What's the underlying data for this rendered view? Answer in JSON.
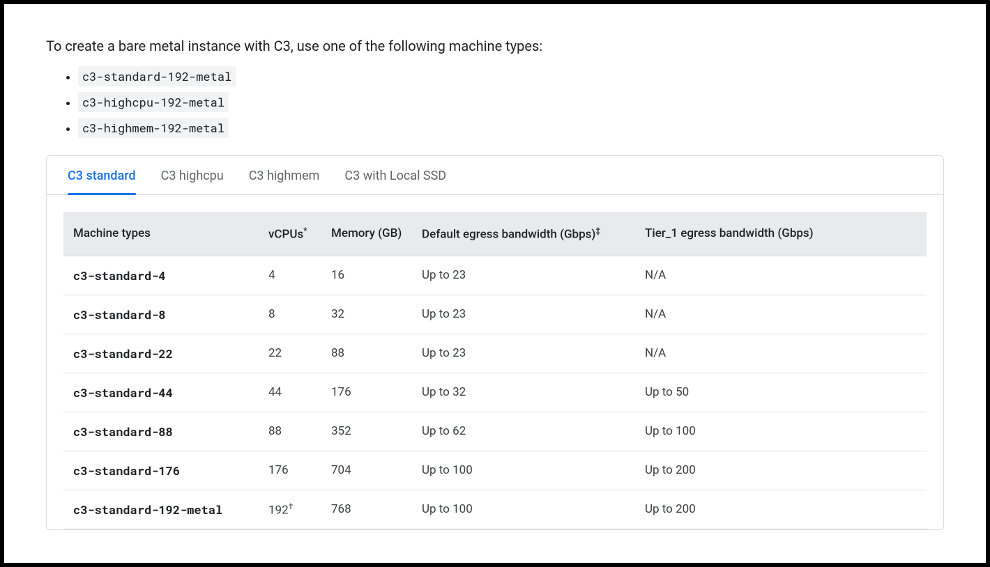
{
  "intro": "To create a bare metal instance with C3, use one of the following machine types:",
  "machine_type_codes": [
    "c3-standard-192-metal",
    "c3-highcpu-192-metal",
    "c3-highmem-192-metal"
  ],
  "tabs": [
    {
      "label": "C3 standard",
      "active": true
    },
    {
      "label": "C3 highcpu",
      "active": false
    },
    {
      "label": "C3 highmem",
      "active": false
    },
    {
      "label": "C3 with Local SSD",
      "active": false
    }
  ],
  "table": {
    "headers": {
      "name": "Machine types",
      "vcpus": "vCPUs",
      "vcpus_sup": "*",
      "memory": "Memory (GB)",
      "default_egress": "Default egress bandwidth (Gbps)",
      "default_egress_sup": "‡",
      "tier1_egress": "Tier_1 egress bandwidth (Gbps)"
    },
    "rows": [
      {
        "name": "c3-standard-4",
        "vcpus": "4",
        "vcpus_sup": "",
        "memory": "16",
        "default_egress": "Up to 23",
        "tier1": "N/A"
      },
      {
        "name": "c3-standard-8",
        "vcpus": "8",
        "vcpus_sup": "",
        "memory": "32",
        "default_egress": "Up to 23",
        "tier1": "N/A"
      },
      {
        "name": "c3-standard-22",
        "vcpus": "22",
        "vcpus_sup": "",
        "memory": "88",
        "default_egress": "Up to 23",
        "tier1": "N/A"
      },
      {
        "name": "c3-standard-44",
        "vcpus": "44",
        "vcpus_sup": "",
        "memory": "176",
        "default_egress": "Up to 32",
        "tier1": "Up to 50"
      },
      {
        "name": "c3-standard-88",
        "vcpus": "88",
        "vcpus_sup": "",
        "memory": "352",
        "default_egress": "Up to 62",
        "tier1": "Up to 100"
      },
      {
        "name": "c3-standard-176",
        "vcpus": "176",
        "vcpus_sup": "",
        "memory": "704",
        "default_egress": "Up to 100",
        "tier1": "Up to 200"
      },
      {
        "name": "c3-standard-192-metal",
        "vcpus": "192",
        "vcpus_sup": "†",
        "memory": "768",
        "default_egress": "Up to 100",
        "tier1": "Up to 200"
      }
    ]
  }
}
